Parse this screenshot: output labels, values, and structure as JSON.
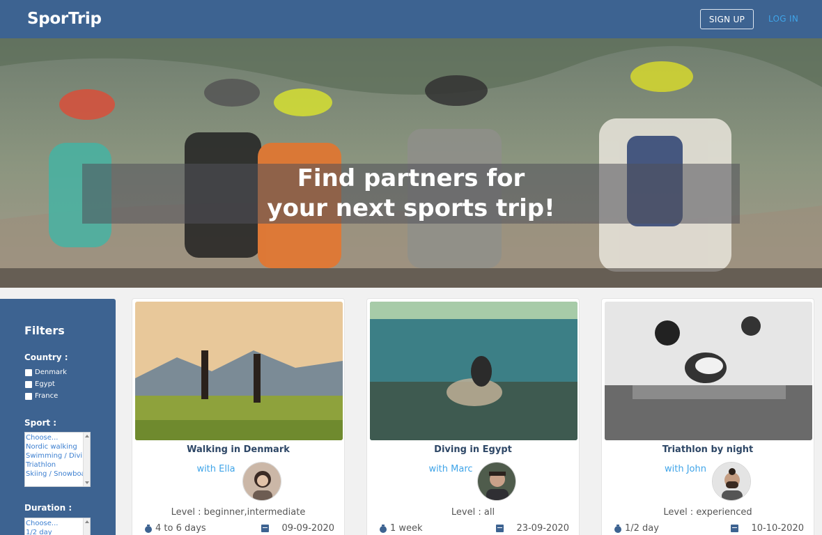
{
  "header": {
    "logo": "SporTrip",
    "signup_label": "SIGN UP",
    "login_label": "LOG IN",
    "bg_color": "#3d6391",
    "login_color": "#3fa4e8"
  },
  "hero": {
    "line1": "Find partners for",
    "line2": "your next sports trip!"
  },
  "filters": {
    "title": "Filters",
    "country_label": "Country :",
    "countries": [
      "Denmark",
      "Egypt",
      "France"
    ],
    "sport_label": "Sport :",
    "sports": [
      "Choose...",
      "Nordic walking",
      "Swimming / Diving",
      "Triathlon",
      "Skiing / Snowboard"
    ],
    "duration_label": "Duration :",
    "durations": [
      "Choose...",
      "1/2 day"
    ]
  },
  "cards": [
    {
      "title": "Walking in Denmark",
      "with": "with Ella",
      "level": "Level : beginner,intermediate",
      "duration": "4 to 6 days",
      "date": "09-09-2020"
    },
    {
      "title": "Diving in Egypt",
      "with": "with Marc",
      "level": "Level : all",
      "duration": "1 week",
      "date": "23-09-2020"
    },
    {
      "title": "Triathlon by night",
      "with": "with John",
      "level": "Level : experienced",
      "duration": "1/2 day",
      "date": "10-10-2020"
    }
  ]
}
